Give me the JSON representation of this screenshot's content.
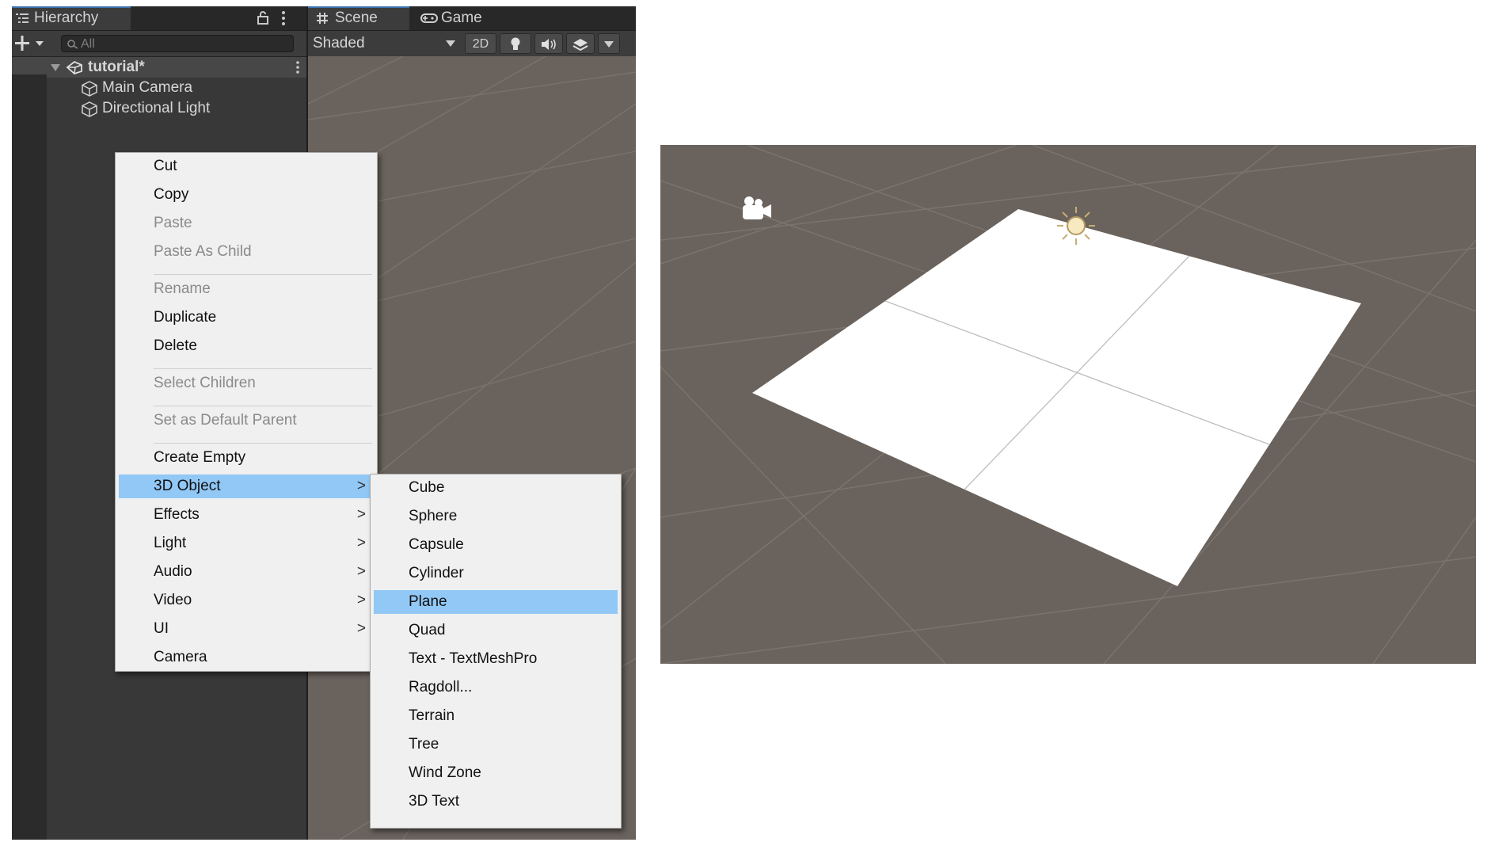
{
  "hierarchy": {
    "tab_label": "Hierarchy",
    "search_placeholder": "All",
    "scene_name": "tutorial*",
    "objects": [
      "Main Camera",
      "Directional Light"
    ]
  },
  "scene_tabs": {
    "scene_label": "Scene",
    "game_label": "Game",
    "shading_mode": "Shaded",
    "mode_2d_label": "2D"
  },
  "context_menu": {
    "items": [
      {
        "label": "Cut",
        "enabled": true
      },
      {
        "label": "Copy",
        "enabled": true
      },
      {
        "label": "Paste",
        "enabled": false
      },
      {
        "label": "Paste As Child",
        "enabled": false
      },
      {
        "label": "Rename",
        "enabled": false
      },
      {
        "label": "Duplicate",
        "enabled": true
      },
      {
        "label": "Delete",
        "enabled": true
      },
      {
        "label": "Select Children",
        "enabled": false
      },
      {
        "label": "Set as Default Parent",
        "enabled": false
      },
      {
        "label": "Create Empty",
        "enabled": true
      },
      {
        "label": "3D Object",
        "enabled": true,
        "submenu": true,
        "highlighted": true
      },
      {
        "label": "Effects",
        "enabled": true,
        "submenu": true
      },
      {
        "label": "Light",
        "enabled": true,
        "submenu": true
      },
      {
        "label": "Audio",
        "enabled": true,
        "submenu": true
      },
      {
        "label": "Video",
        "enabled": true,
        "submenu": true
      },
      {
        "label": "UI",
        "enabled": true,
        "submenu": true
      },
      {
        "label": "Camera",
        "enabled": true
      }
    ],
    "submenu_arrow": ">"
  },
  "submenu_3d_object": {
    "items": [
      {
        "label": "Cube"
      },
      {
        "label": "Sphere"
      },
      {
        "label": "Capsule"
      },
      {
        "label": "Cylinder"
      },
      {
        "label": "Plane",
        "highlighted": true
      },
      {
        "label": "Quad"
      },
      {
        "label": "Text - TextMeshPro"
      },
      {
        "label": "Ragdoll..."
      },
      {
        "label": "Terrain"
      },
      {
        "label": "Tree"
      },
      {
        "label": "Wind Zone"
      },
      {
        "label": "3D Text"
      }
    ]
  },
  "colors": {
    "menu_highlight": "#91c8f6",
    "scene_background": "#6a625c",
    "plane_color": "#ffffff",
    "editor_panel": "#383838"
  },
  "icons": [
    "hierarchy-list-icon",
    "lock-icon",
    "kebab-menu-icon",
    "add-icon",
    "search-icon",
    "unity-scene-icon",
    "gameobject-cube-icon",
    "grid-icon",
    "gamepad-icon",
    "lightbulb-icon",
    "speaker-icon",
    "layers-icon",
    "camera-gizmo-icon",
    "sun-gizmo-icon"
  ]
}
